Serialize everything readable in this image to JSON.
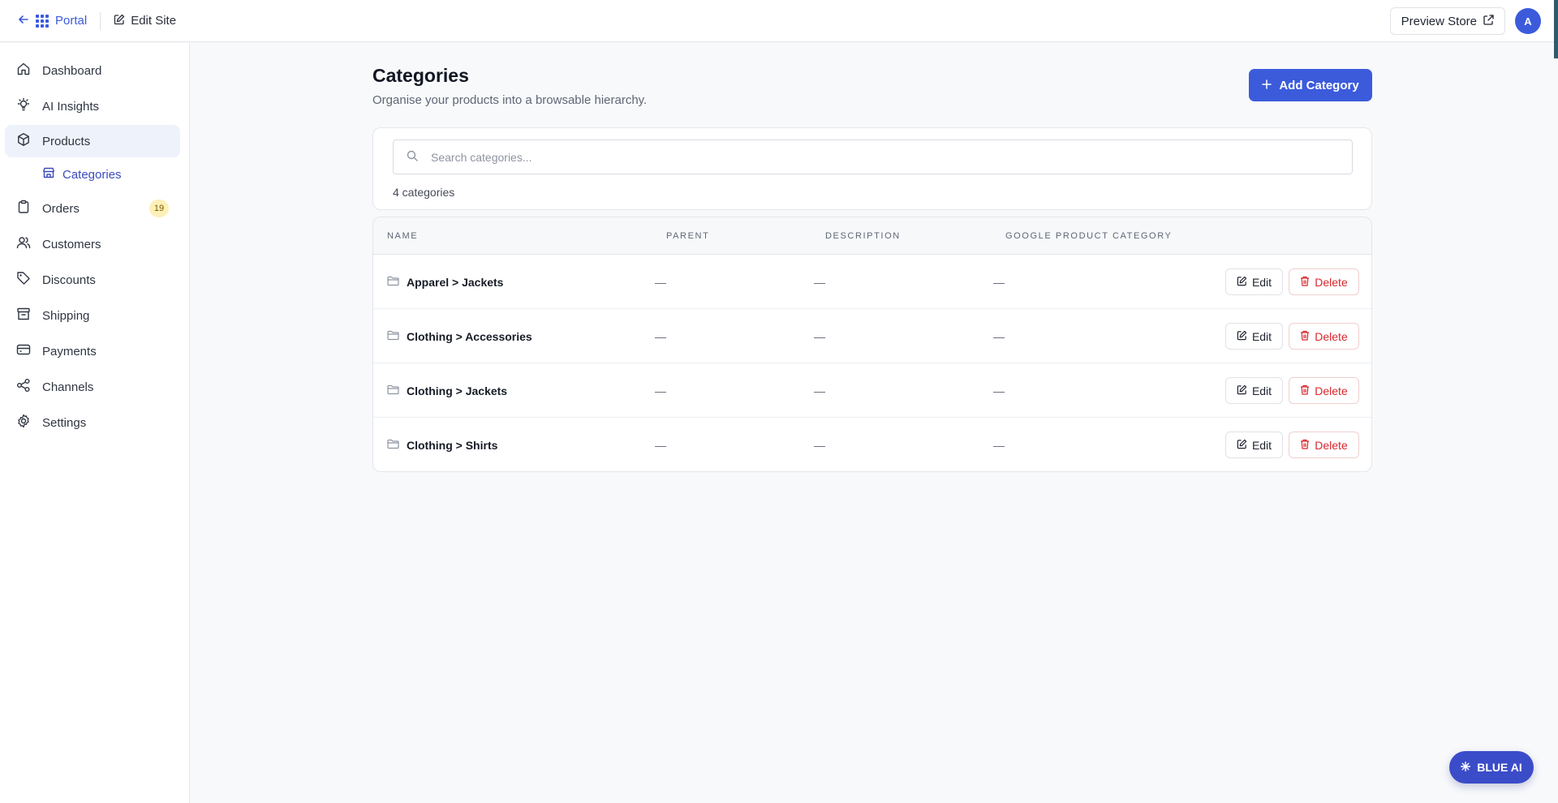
{
  "topbar": {
    "portal_label": "Portal",
    "edit_site_label": "Edit Site",
    "preview_store_label": "Preview Store",
    "avatar_initial": "A"
  },
  "sidebar": {
    "items": [
      {
        "label": "Dashboard",
        "icon": "home-icon"
      },
      {
        "label": "AI Insights",
        "icon": "lightbulb-icon"
      },
      {
        "label": "Products",
        "icon": "box-icon"
      },
      {
        "label": "Orders",
        "icon": "clipboard-icon",
        "badge": "19"
      },
      {
        "label": "Customers",
        "icon": "users-icon"
      },
      {
        "label": "Discounts",
        "icon": "tag-icon"
      },
      {
        "label": "Shipping",
        "icon": "archive-icon"
      },
      {
        "label": "Payments",
        "icon": "credit-card-icon"
      },
      {
        "label": "Channels",
        "icon": "share-icon"
      },
      {
        "label": "Settings",
        "icon": "gear-icon"
      }
    ],
    "sub_item": {
      "label": "Categories",
      "icon": "store-icon"
    }
  },
  "page": {
    "title": "Categories",
    "subtitle": "Organise your products into a browsable hierarchy.",
    "add_button": "Add Category"
  },
  "search": {
    "placeholder": "Search categories...",
    "value": "",
    "count_text": "4 categories"
  },
  "table": {
    "columns": [
      "Name",
      "Parent",
      "Description",
      "Google Product Category"
    ],
    "rows": [
      {
        "name": "Apparel > Jackets",
        "parent": "—",
        "description": "—",
        "google_category": "—"
      },
      {
        "name": "Clothing > Accessories",
        "parent": "—",
        "description": "—",
        "google_category": "—"
      },
      {
        "name": "Clothing > Jackets",
        "parent": "—",
        "description": "—",
        "google_category": "—"
      },
      {
        "name": "Clothing > Shirts",
        "parent": "—",
        "description": "—",
        "google_category": "—"
      }
    ],
    "edit_label": "Edit",
    "delete_label": "Delete"
  },
  "assistant": {
    "label": "BLUE AI"
  },
  "colors": {
    "accent": "#3b5bdb",
    "danger": "#d9262c",
    "badge_bg": "#fdf0b8"
  }
}
